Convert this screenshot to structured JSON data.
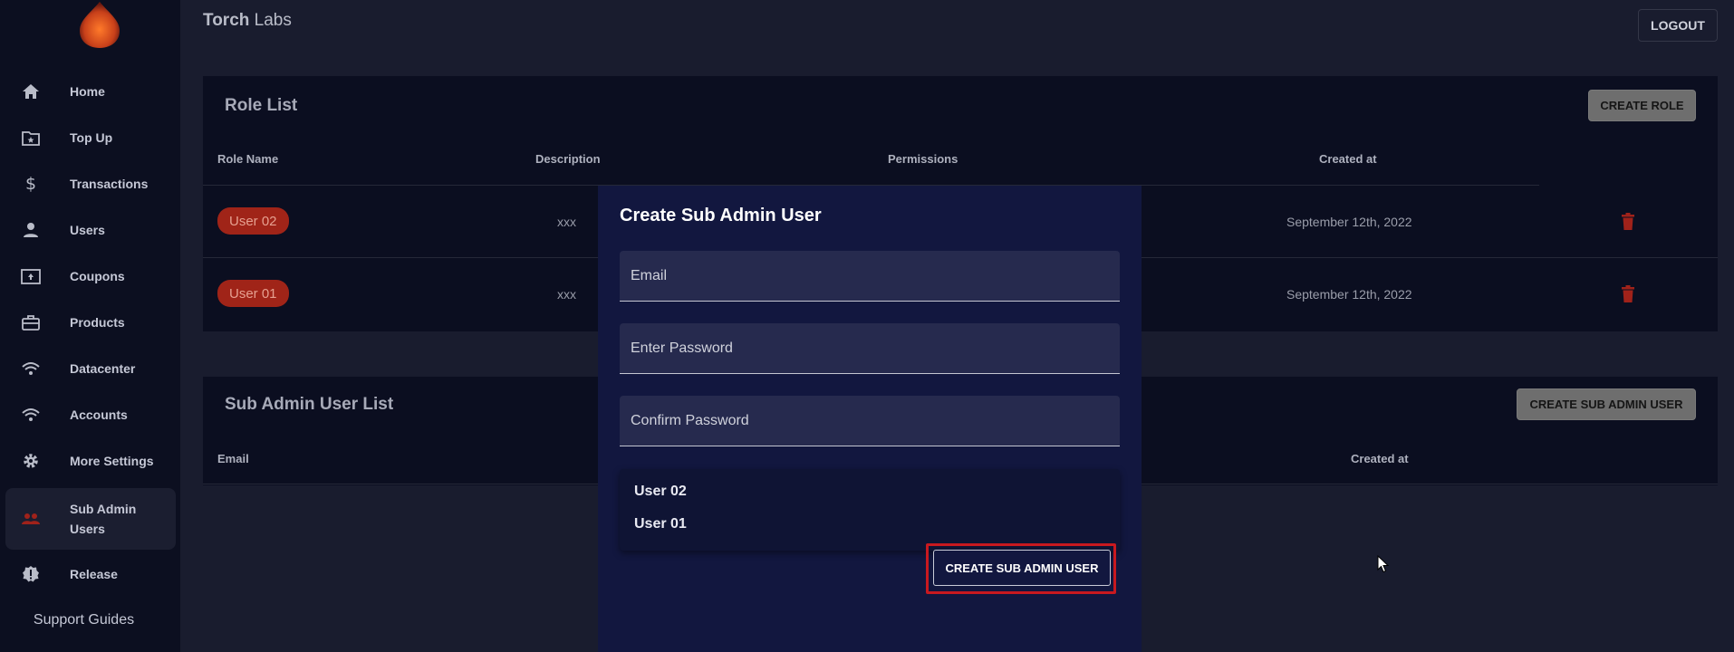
{
  "header": {
    "brand_bold": "Torch",
    "brand_light": " Labs",
    "logout_label": "LOGOUT"
  },
  "sidebar": {
    "items": [
      {
        "label": "Home",
        "icon": "home-icon"
      },
      {
        "label": "Top Up",
        "icon": "folder-star-icon"
      },
      {
        "label": "Transactions",
        "icon": "dollar-icon"
      },
      {
        "label": "Users",
        "icon": "person-icon"
      },
      {
        "label": "Coupons",
        "icon": "coupon-icon"
      },
      {
        "label": "Products",
        "icon": "briefcase-icon"
      },
      {
        "label": "Datacenter",
        "icon": "wifi-icon"
      },
      {
        "label": "Accounts",
        "icon": "wifi-icon"
      },
      {
        "label": "More Settings",
        "icon": "gear-icon"
      },
      {
        "label": "Sub Admin Users",
        "icon": "group-icon",
        "active": true
      },
      {
        "label": "Release",
        "icon": "badge-alert-icon"
      }
    ],
    "support_label": "Support Guides"
  },
  "role_list": {
    "title": "Role List",
    "create_label": "CREATE ROLE",
    "columns": [
      "Role Name",
      "Description",
      "Permissions",
      "Created at"
    ],
    "rows": [
      {
        "role": "User 02",
        "description": "xxx",
        "created_at": "September 12th, 2022"
      },
      {
        "role": "User 01",
        "description": "xxx",
        "created_at": "September 12th, 2022"
      }
    ]
  },
  "sub_admin_list": {
    "title": "Sub Admin User List",
    "create_label": "CREATE SUB ADMIN USER",
    "columns": [
      "Email",
      "Created at"
    ]
  },
  "modal": {
    "title": "Create Sub Admin User",
    "email_placeholder": "Email",
    "password_placeholder": "Enter Password",
    "confirm_placeholder": "Confirm Password",
    "role_options": [
      "User 02",
      "User 01"
    ],
    "submit_label": "CREATE SUB ADMIN USER"
  },
  "colors": {
    "accent_red": "#c8191f",
    "pill_red": "#a02418",
    "modal_bg": "#12173f",
    "logo_orange": "#d2501e"
  }
}
